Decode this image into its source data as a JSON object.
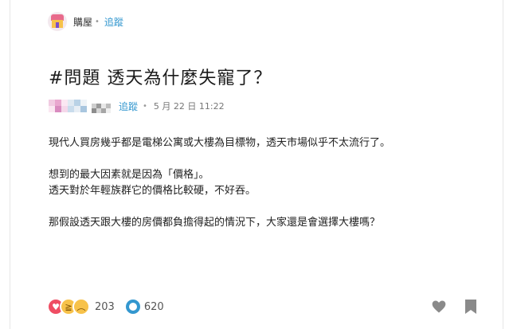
{
  "board": {
    "name": "購屋",
    "follow_label": "追蹤"
  },
  "post": {
    "title": "#問題 透天為什麼失寵了？",
    "author_follow_label": "追蹤",
    "time": "5 月 22 日 11:22",
    "body": [
      "現代人買房幾乎都是電梯公寓或大樓為目標物，透天市場似乎不太流行了。",
      "",
      "想到的最大因素就是因為「價格」。",
      "透天對於年輕族群它的價格比較硬，不好吞。",
      "",
      "那假設透天跟大樓的房價都負擔得起的情況下，大家還是會選擇大樓嗎？"
    ]
  },
  "footer": {
    "reaction_count": "203",
    "comment_count": "620",
    "reaction_icons": [
      "heart-icon",
      "laugh-icon",
      "sad-icon"
    ]
  },
  "colors": {
    "link": "#3397cf",
    "heart": "#ef4d63",
    "emoji": "#f7c24a",
    "icon_gray": "#888888"
  }
}
